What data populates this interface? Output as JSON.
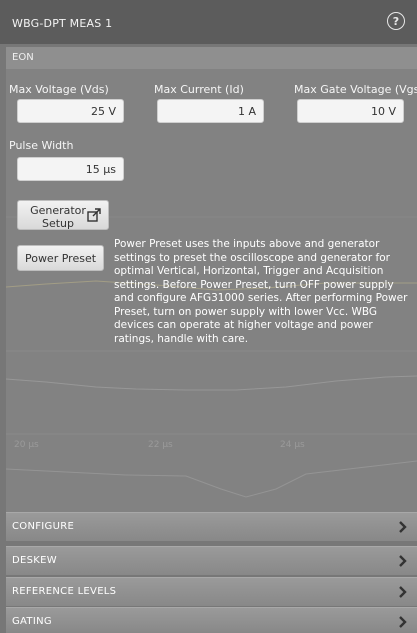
{
  "window": {
    "title": "WBG-DPT MEAS 1",
    "help_icon": "question-circle-icon"
  },
  "section": {
    "label": "EON"
  },
  "fields": {
    "max_voltage": {
      "label": "Max Voltage (Vds)",
      "value": "25 V"
    },
    "max_current": {
      "label": "Max Current (Id)",
      "value": "1 A"
    },
    "max_gate_voltage": {
      "label": "Max Gate Voltage (Vgs)",
      "value": "10 V"
    },
    "pulse_width": {
      "label": "Pulse Width",
      "value": "15 µs"
    }
  },
  "buttons": {
    "generator_setup": {
      "line1": "Generator",
      "line2": "Setup",
      "icon": "external-link-icon"
    },
    "power_preset": {
      "label": "Power Preset"
    }
  },
  "description": "Power Preset uses the inputs above and generator settings to preset the oscilloscope and generator for optimal Vertical, Horizontal, Trigger and Acquisition settings. Before Power Preset, turn OFF power supply and configure AFG31000 series. After performing Power Preset, turn on power supply with lower Vcc. WBG devices can operate at higher voltage and power ratings, handle with care.",
  "background_axis": {
    "labels": [
      "20 µs",
      "22 µs",
      "24 µs"
    ]
  },
  "menu": [
    {
      "label": "CONFIGURE",
      "icon": "chevron-right-icon"
    },
    {
      "label": "DESKEW",
      "icon": "chevron-right-icon"
    },
    {
      "label": "REFERENCE LEVELS",
      "icon": "chevron-right-icon"
    },
    {
      "label": "GATING",
      "icon": "chevron-right-icon"
    }
  ],
  "colors": {
    "title_bar": "#5c5c5c",
    "panel": "#828282",
    "input_bg": "#f4f4f4"
  }
}
